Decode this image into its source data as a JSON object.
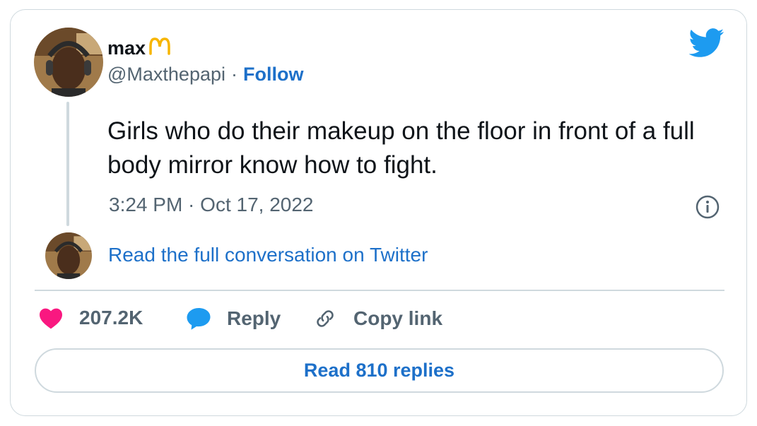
{
  "user": {
    "display_name": "max",
    "badge_icon": "mcdonalds-arches-emoji",
    "handle": "@Maxthepapi",
    "separator": "·",
    "follow_label": "Follow"
  },
  "tweet": {
    "text": "Girls who do their makeup on the floor in front of a full body mirror know how to fight.",
    "timestamp": "3:24 PM · Oct 17, 2022"
  },
  "conversation": {
    "link_label": "Read the full conversation on Twitter"
  },
  "actions": {
    "likes_count": "207.2K",
    "reply_label": "Reply",
    "copy_label": "Copy link"
  },
  "replies_button": {
    "label": "Read 810 replies"
  },
  "colors": {
    "link_blue": "#1d70c9",
    "twitter_blue": "#1d9bf0",
    "heart_pink": "#f91880",
    "muted_gray": "#536471",
    "border_gray": "#cfd9de"
  }
}
